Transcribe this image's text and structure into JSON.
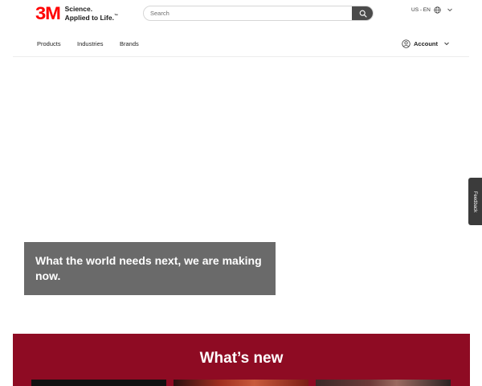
{
  "brand": {
    "logo_text": "3M",
    "tagline_line1": "Science.",
    "tagline_line2": "Applied to Life.",
    "tagline_tm": "™",
    "color": "#ff0000"
  },
  "search": {
    "placeholder": "Search",
    "value": "",
    "button_icon": "search-icon"
  },
  "locale": {
    "label": "US - EN",
    "icon": "globe-icon"
  },
  "nav": {
    "items": [
      {
        "label": "Products"
      },
      {
        "label": "Industries"
      },
      {
        "label": "Brands"
      }
    ]
  },
  "account": {
    "label": "Account",
    "icon": "user-circle-icon"
  },
  "hero": {
    "headline": "What the world needs next, we are making now."
  },
  "feedback": {
    "label": "Feedback"
  },
  "whats_new": {
    "title": "What’s new",
    "background": "#8e0b23"
  }
}
